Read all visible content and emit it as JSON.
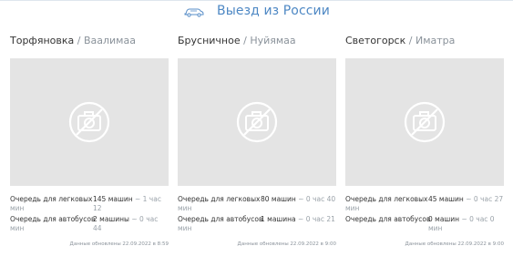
{
  "header": {
    "title": "Выезд из России",
    "icon": "car-icon",
    "accent": "#4e88c4"
  },
  "crossings": [
    {
      "name": "Торфяновка",
      "separator": " / ",
      "counterpart": "Ваалимаа",
      "photo_icon": "no-photo-icon",
      "rows": [
        {
          "label": "Очередь для легковых",
          "count": "145 машин",
          "time": "~ 1 час 12",
          "time_wrap": "мин"
        },
        {
          "label": "Очередь для автобусов",
          "count": "2 машины",
          "time": "~ 0 час 44",
          "time_wrap": "мин"
        }
      ],
      "updated": "Данные обновлены 22.09.2022 в 8:59"
    },
    {
      "name": "Брусничное",
      "separator": " / ",
      "counterpart": "Нуйямаа",
      "photo_icon": "no-photo-icon",
      "rows": [
        {
          "label": "Очередь для легковых",
          "count": "80 машин",
          "time": "~ 0 час 40",
          "time_wrap": "мин"
        },
        {
          "label": "Очередь для автобусов",
          "count": "1 машина",
          "time": "~ 0 час 21",
          "time_wrap": "мин"
        }
      ],
      "updated": "Данные обновлены 22.09.2022 в 9:00"
    },
    {
      "name": "Светогорск",
      "separator": " / ",
      "counterpart": "Иматра",
      "photo_icon": "no-photo-icon",
      "rows": [
        {
          "label": "Очередь для легковых",
          "count": "45 машин",
          "time": "~ 0 час 27",
          "time_wrap": "мин"
        },
        {
          "label": "Очередь для автобусов",
          "count": "0 машин",
          "time": "~ 0 час 0 мин",
          "time_wrap": ""
        }
      ],
      "updated": "Данные обновлены 22.09.2022 в 9:00"
    }
  ]
}
